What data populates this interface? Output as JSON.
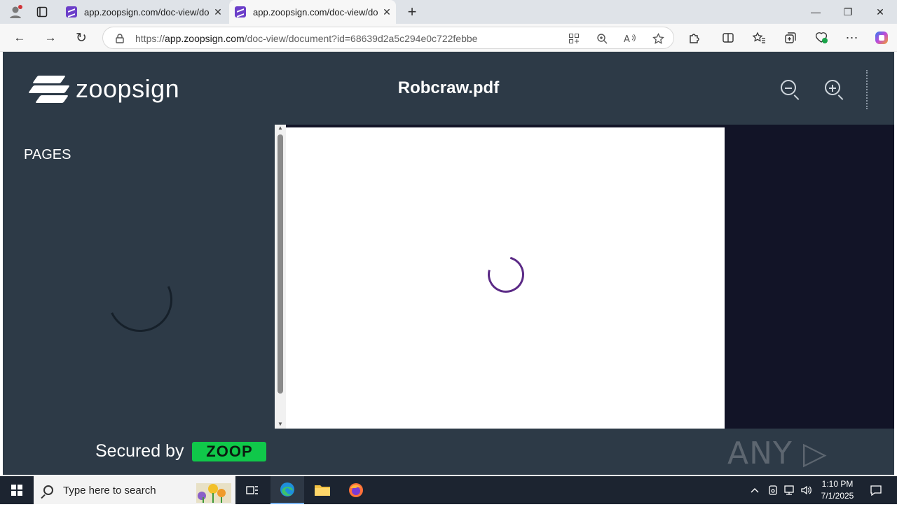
{
  "browser": {
    "tabs": [
      {
        "title": "app.zoopsign.com/doc-view/docu",
        "close": "✕"
      },
      {
        "title": "app.zoopsign.com/doc-view/docu",
        "close": "✕"
      }
    ],
    "new_tab": "+",
    "window": {
      "minimize": "—",
      "restore": "❐",
      "close": "✕"
    },
    "url": {
      "scheme": "https://",
      "host": "app.zoopsign.com",
      "path": "/doc-view/document?id=68639d2a5c294e0c722febbe"
    },
    "nav": {
      "back": "←",
      "forward": "→",
      "reload": "↻"
    }
  },
  "app": {
    "brand": "zoopsign",
    "document_title": "Robcraw.pdf",
    "sidebar_title": "PAGES",
    "footer": {
      "secured_by": "Secured by",
      "partner": "ZOOP"
    },
    "watermark": "ANY ▷ RUN"
  },
  "taskbar": {
    "search_placeholder": "Type here to search",
    "time": "1:10 PM",
    "date": "7/1/2025"
  },
  "colors": {
    "app_bg": "#2d3a47",
    "viewer_bg": "#121427",
    "spinner": "#5b2a86",
    "zoop_green": "#10c84a"
  }
}
